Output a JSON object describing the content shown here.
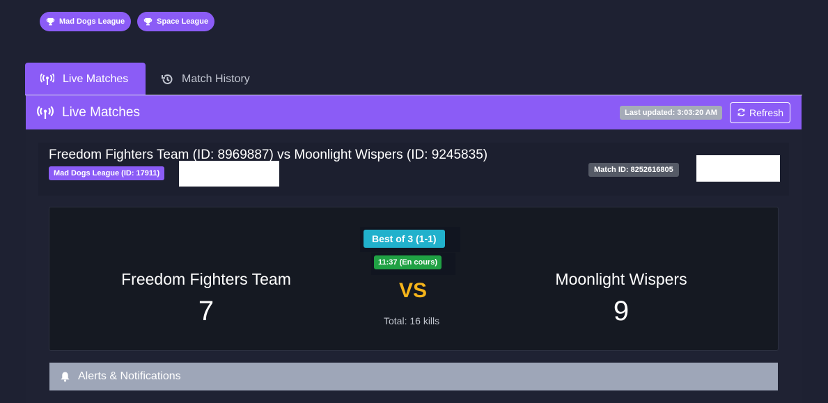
{
  "leagues": [
    {
      "label": "Mad Dogs League"
    },
    {
      "label": "Space League"
    }
  ],
  "tabs": [
    {
      "label": "Live Matches",
      "active": true
    },
    {
      "label": "Match History",
      "active": false
    }
  ],
  "panel": {
    "title": "Live Matches",
    "last_updated": "Last updated: 3:03:20 AM",
    "refresh_label": "Refresh"
  },
  "match": {
    "title": "Freedom Fighters Team (ID: 8969887) vs Moonlight Wispers (ID: 9245835)",
    "league_badge": "Mad Dogs League (ID: 17911)",
    "match_id": "Match ID: 8252616805",
    "series": "Best of 3 (1-1)",
    "status": "11:37 (En cours)",
    "vs": "VS",
    "total": "Total: 16 kills",
    "team_left": {
      "name": "Freedom Fighters Team",
      "score": "7"
    },
    "team_right": {
      "name": "Moonlight Wispers",
      "score": "9"
    }
  },
  "alerts": {
    "label": "Alerts & Notifications"
  },
  "colors": {
    "accent": "#8b5cf6",
    "background": "#1e2132",
    "series_badge": "#21b1cc",
    "status_badge": "#20a144",
    "vs": "#f5b41a"
  },
  "icons": [
    "trophy-icon",
    "broadcast-icon",
    "history-icon",
    "refresh-icon",
    "bell-icon"
  ]
}
